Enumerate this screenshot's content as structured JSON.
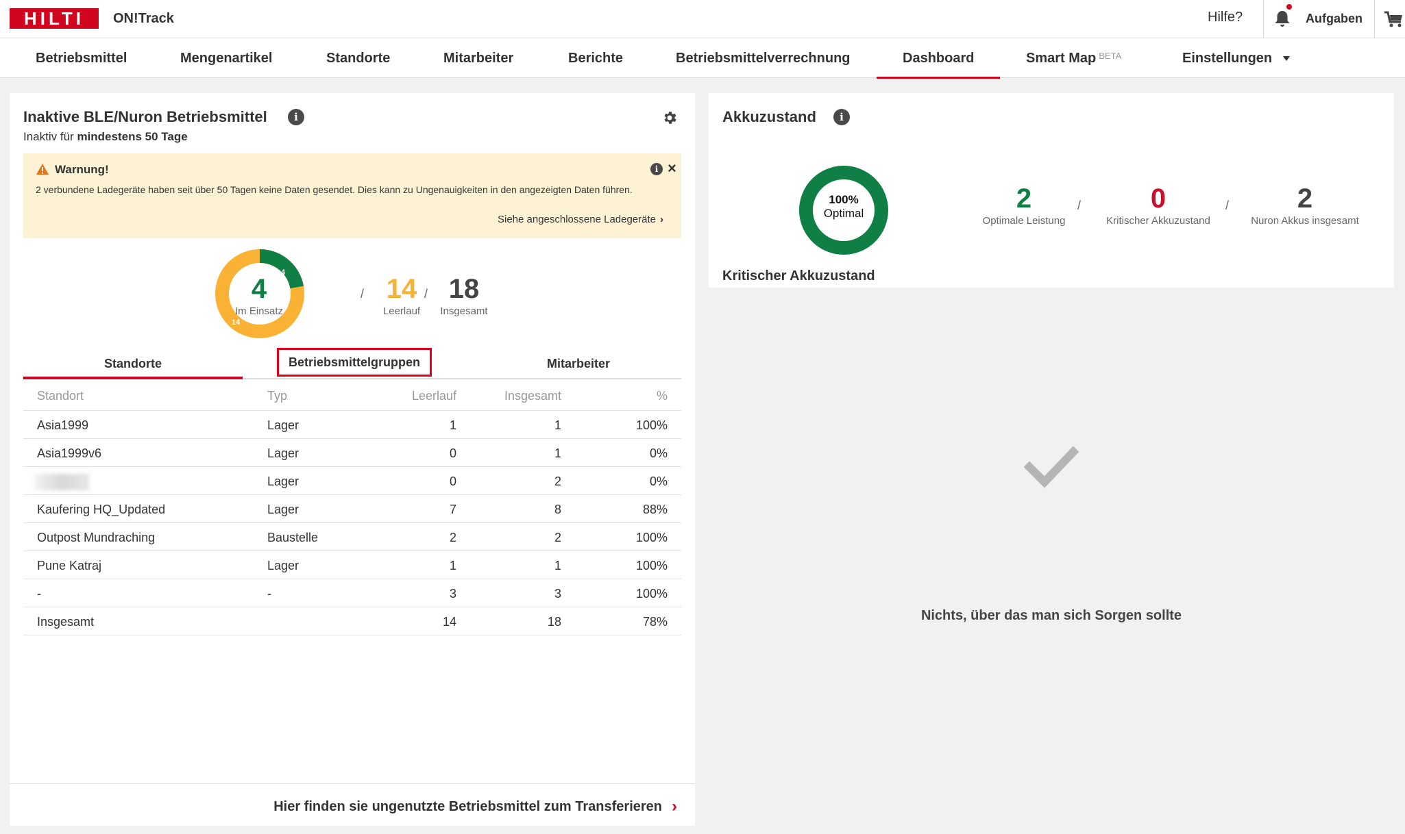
{
  "header": {
    "logo": "HILTI",
    "app_title": "ON!Track",
    "help": "Hilfe?",
    "tasks": "Aufgaben",
    "bell_icon": "bell-icon",
    "cart_icon": "cart-icon"
  },
  "nav": {
    "items": [
      {
        "label": "Betriebsmittel"
      },
      {
        "label": "Mengenartikel"
      },
      {
        "label": "Standorte"
      },
      {
        "label": "Mitarbeiter"
      },
      {
        "label": "Berichte"
      },
      {
        "label": "Betriebsmittelverrechnung"
      },
      {
        "label": "Dashboard",
        "active": true
      },
      {
        "label": "Smart Map",
        "badge": "BETA"
      },
      {
        "label": "Einstellungen"
      }
    ]
  },
  "inactive_panel": {
    "title": "Inaktive BLE/Nuron Betriebsmittel",
    "subtitle_prefix": "Inaktiv für",
    "subtitle_bold": "mindestens 50 Tage",
    "warning": {
      "title": "Warnung!",
      "text": "2 verbundene Ladegeräte haben seit über 50 Tagen keine Daten gesendet. Dies kann zu Ungenauigkeiten in den angezeigten Daten führen.",
      "link": "Siehe angeschlossene Ladegeräte"
    },
    "donut": {
      "in_use": 4,
      "idle": 14,
      "in_use_color": "#0f7f45",
      "idle_color": "#f9b233"
    },
    "stats": {
      "in_use_value": "4",
      "in_use_label": "Im Einsatz",
      "idle_value": "14",
      "idle_label": "Leerlauf",
      "total_value": "18",
      "total_label": "Insgesamt"
    },
    "tabs": [
      {
        "label": "Standorte",
        "active": true
      },
      {
        "label": "Betriebsmittelgruppen",
        "highlighted": true
      },
      {
        "label": "Mitarbeiter"
      }
    ],
    "table": {
      "headers": [
        "Standort",
        "Typ",
        "Leerlauf",
        "Insgesamt",
        "%"
      ],
      "rows": [
        [
          "Asia1999",
          "Lager",
          "1",
          "1",
          "100%"
        ],
        [
          "Asia1999v6",
          "Lager",
          "0",
          "1",
          "0%"
        ],
        [
          "",
          "Lager",
          "0",
          "2",
          "0%"
        ],
        [
          "Kaufering HQ_Updated",
          "Lager",
          "7",
          "8",
          "88%"
        ],
        [
          "Outpost Mundraching",
          "Baustelle",
          "2",
          "2",
          "100%"
        ],
        [
          "Pune Katraj",
          "Lager",
          "1",
          "1",
          "100%"
        ],
        [
          "-",
          "-",
          "3",
          "3",
          "100%"
        ],
        [
          "Insgesamt",
          "",
          "14",
          "18",
          "78%"
        ]
      ]
    },
    "footer_link": "Hier finden sie ungenutzte Betriebsmittel zum Transferieren"
  },
  "battery_panel": {
    "title": "Akkuzustand",
    "donut_pct": "100%",
    "donut_label": "Optimal",
    "optimal_fraction": 1.0,
    "colors": {
      "good": "#0f7f45",
      "critical": "#c8102e",
      "neutral": "#444444"
    },
    "stats": {
      "optimal_value": "2",
      "optimal_label": "Optimale Leistung",
      "critical_value": "0",
      "critical_label": "Kritischer Akkuzustand",
      "total_value": "2",
      "total_label": "Nuron Akkus insgesamt"
    },
    "section_title": "Kritischer Akkuzustand",
    "empty_message": "Nichts, über das man sich Sorgen sollte"
  }
}
